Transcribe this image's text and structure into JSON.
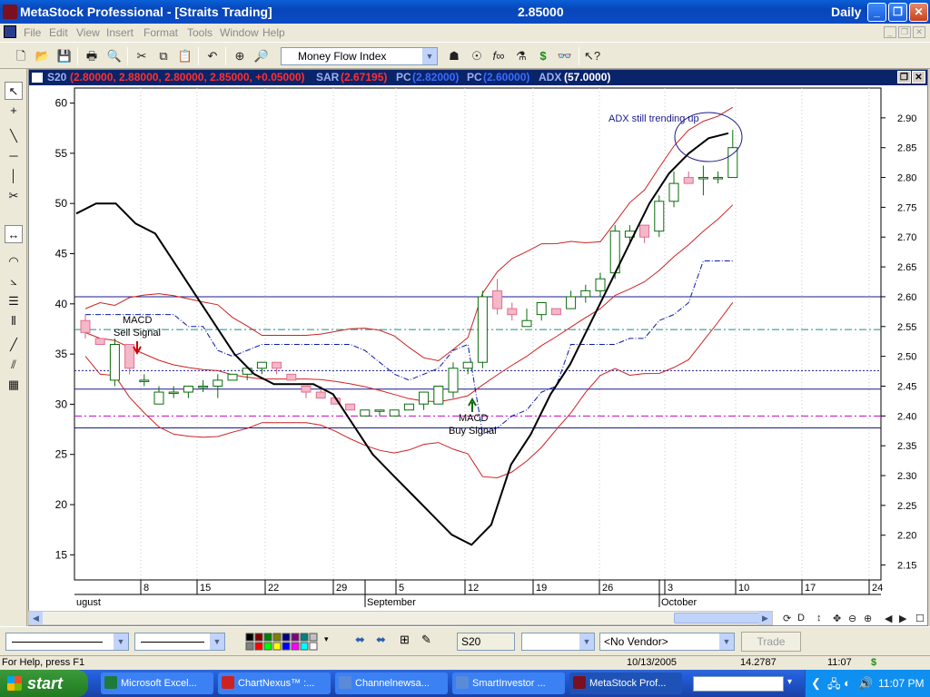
{
  "window": {
    "title": "MetaStock Professional - [Straits Trading]",
    "price": "2.85000",
    "period": "Daily"
  },
  "menu": [
    "File",
    "Edit",
    "View",
    "Insert",
    "Format",
    "Tools",
    "Window",
    "Help"
  ],
  "toolbar": {
    "indicator_select": "Money Flow Index"
  },
  "chart_header": {
    "symbol": "S20",
    "ohlc": "(2.80000, 2.88000, 2.80000, 2.85000, +0.05000)",
    "sar_label": "SAR",
    "sar_value": "(2.67195)",
    "pc1_label": "PC",
    "pc1_value": "(2.82000)",
    "pc2_label": "PC",
    "pc2_value": "(2.60000)",
    "adx_label": "ADX",
    "adx_value": "(57.0000)"
  },
  "annotations": {
    "adx_note": "ADX still trending up",
    "macd_sell_1": "MACD",
    "macd_sell_2": "Sell Signal",
    "macd_buy_1": "MACD",
    "macd_buy_2": "Buy Signal"
  },
  "chart_data": {
    "type": "candlestick",
    "left_axis": {
      "label": "ADX",
      "ticks": [
        60,
        55,
        50,
        45,
        40,
        35,
        30,
        25,
        20,
        15
      ],
      "ylim": [
        12.5,
        61.5
      ]
    },
    "right_axis": {
      "label": "Price",
      "ticks": [
        2.9,
        2.85,
        2.8,
        2.75,
        2.7,
        2.65,
        2.6,
        2.55,
        2.5,
        2.45,
        2.4,
        2.35,
        2.3,
        2.25,
        2.2,
        2.15
      ],
      "ticks_text": [
        "2.90",
        "2.85",
        "2.80",
        "2.75",
        "2.70",
        "2.65",
        "2.60",
        "2.55",
        "2.50",
        "2.45",
        "2.40",
        "2.35",
        "2.30",
        "2.25",
        "2.20",
        "2.15"
      ],
      "ylim": [
        2.125,
        2.95
      ]
    },
    "x_day_ticks": [
      "8",
      "15",
      "22",
      "29",
      "5",
      "12",
      "19",
      "26",
      "3",
      "10",
      "17",
      "24"
    ],
    "x_month_labels": [
      "ugust",
      "September",
      "October"
    ],
    "candles": [
      {
        "o": 2.56,
        "h": 2.57,
        "l": 2.53,
        "c": 2.54
      },
      {
        "o": 2.53,
        "h": 2.53,
        "l": 2.52,
        "c": 2.52
      },
      {
        "o": 2.46,
        "h": 2.53,
        "l": 2.45,
        "c": 2.52
      },
      {
        "o": 2.52,
        "h": 2.52,
        "l": 2.47,
        "c": 2.48
      },
      {
        "o": 2.46,
        "h": 2.47,
        "l": 2.45,
        "c": 2.46
      },
      {
        "o": 2.42,
        "h": 2.45,
        "l": 2.42,
        "c": 2.44
      },
      {
        "o": 2.44,
        "h": 2.45,
        "l": 2.43,
        "c": 2.44
      },
      {
        "o": 2.44,
        "h": 2.45,
        "l": 2.43,
        "c": 2.45
      },
      {
        "o": 2.45,
        "h": 2.46,
        "l": 2.44,
        "c": 2.45
      },
      {
        "o": 2.45,
        "h": 2.47,
        "l": 2.43,
        "c": 2.46
      },
      {
        "o": 2.46,
        "h": 2.47,
        "l": 2.46,
        "c": 2.47
      },
      {
        "o": 2.47,
        "h": 2.48,
        "l": 2.46,
        "c": 2.48
      },
      {
        "o": 2.48,
        "h": 2.49,
        "l": 2.47,
        "c": 2.49
      },
      {
        "o": 2.49,
        "h": 2.49,
        "l": 2.47,
        "c": 2.48
      },
      {
        "o": 2.47,
        "h": 2.47,
        "l": 2.46,
        "c": 2.46
      },
      {
        "o": 2.45,
        "h": 2.45,
        "l": 2.43,
        "c": 2.44
      },
      {
        "o": 2.44,
        "h": 2.45,
        "l": 2.43,
        "c": 2.43
      },
      {
        "o": 2.43,
        "h": 2.43,
        "l": 2.42,
        "c": 2.42
      },
      {
        "o": 2.42,
        "h": 2.42,
        "l": 2.41,
        "c": 2.41
      },
      {
        "o": 2.4,
        "h": 2.41,
        "l": 2.4,
        "c": 2.41
      },
      {
        "o": 2.41,
        "h": 2.41,
        "l": 2.4,
        "c": 2.41
      },
      {
        "o": 2.4,
        "h": 2.41,
        "l": 2.4,
        "c": 2.41
      },
      {
        "o": 2.41,
        "h": 2.42,
        "l": 2.41,
        "c": 2.42
      },
      {
        "o": 2.42,
        "h": 2.44,
        "l": 2.41,
        "c": 2.44
      },
      {
        "o": 2.42,
        "h": 2.45,
        "l": 2.42,
        "c": 2.45
      },
      {
        "o": 2.44,
        "h": 2.49,
        "l": 2.43,
        "c": 2.48
      },
      {
        "o": 2.48,
        "h": 2.49,
        "l": 2.47,
        "c": 2.49
      },
      {
        "o": 2.49,
        "h": 2.61,
        "l": 2.48,
        "c": 2.6
      },
      {
        "o": 2.61,
        "h": 2.63,
        "l": 2.57,
        "c": 2.58
      },
      {
        "o": 2.58,
        "h": 2.59,
        "l": 2.56,
        "c": 2.57
      },
      {
        "o": 2.55,
        "h": 2.58,
        "l": 2.55,
        "c": 2.56
      },
      {
        "o": 2.57,
        "h": 2.59,
        "l": 2.56,
        "c": 2.59
      },
      {
        "o": 2.58,
        "h": 2.58,
        "l": 2.57,
        "c": 2.57
      },
      {
        "o": 2.58,
        "h": 2.61,
        "l": 2.58,
        "c": 2.6
      },
      {
        "o": 2.6,
        "h": 2.62,
        "l": 2.59,
        "c": 2.61
      },
      {
        "o": 2.61,
        "h": 2.64,
        "l": 2.6,
        "c": 2.63
      },
      {
        "o": 2.64,
        "h": 2.72,
        "l": 2.63,
        "c": 2.71
      },
      {
        "o": 2.7,
        "h": 2.72,
        "l": 2.69,
        "c": 2.71
      },
      {
        "o": 2.72,
        "h": 2.72,
        "l": 2.69,
        "c": 2.7
      },
      {
        "o": 2.71,
        "h": 2.77,
        "l": 2.7,
        "c": 2.76
      },
      {
        "o": 2.76,
        "h": 2.81,
        "l": 2.75,
        "c": 2.79
      },
      {
        "o": 2.8,
        "h": 2.81,
        "l": 2.79,
        "c": 2.79
      },
      {
        "o": 2.8,
        "h": 2.82,
        "l": 2.77,
        "c": 2.8
      },
      {
        "o": 2.8,
        "h": 2.81,
        "l": 2.79,
        "c": 2.8
      },
      {
        "o": 2.8,
        "h": 2.88,
        "l": 2.8,
        "c": 2.85
      }
    ],
    "adx_line": [
      49,
      50,
      50,
      48,
      47,
      44,
      41,
      38,
      35,
      33,
      32,
      32,
      32,
      31,
      28,
      25,
      23,
      21,
      19,
      17,
      16,
      18,
      24,
      27,
      31,
      34,
      38,
      42,
      46,
      50,
      53,
      55,
      56.5,
      57
    ],
    "reference_lines": [
      {
        "value": 2.6,
        "color": "#1a1a8c",
        "style": "solid"
      },
      {
        "value": 2.545,
        "color": "#1a8c8c",
        "style": "dash-dot"
      },
      {
        "value": 2.476,
        "color": "#1a1a8c",
        "style": "dotted"
      },
      {
        "value": 2.445,
        "color": "#1a1a8c",
        "style": "solid"
      },
      {
        "value": 2.4,
        "color": "#cc00cc",
        "style": "dash-dot"
      },
      {
        "value": 2.38,
        "color": "#1a1a8c",
        "style": "solid"
      }
    ]
  },
  "bottom": {
    "symbol_field": "S20",
    "vendor_select": "<No Vendor>",
    "trade_button": "Trade",
    "letter_d": "D"
  },
  "help": {
    "text": "For Help, press F1",
    "date": "10/13/2005",
    "value": "14.2787",
    "time": "11:07",
    "dollar": "$"
  },
  "taskbar": {
    "start": "start",
    "tasks": [
      "Microsoft Excel...",
      "ChartNexus™ :...",
      "Channelnewsa...",
      "SmartInvestor ...",
      "MetaStock Prof..."
    ],
    "clock": "11:07 PM"
  },
  "colors": {
    "candle_up": "#0a6b0a",
    "candle_down": "#f4b8c8",
    "band": "#cc2222",
    "sar": "#0a1aa8",
    "adx": "#000000",
    "title_blue": "#0a4cc6"
  }
}
